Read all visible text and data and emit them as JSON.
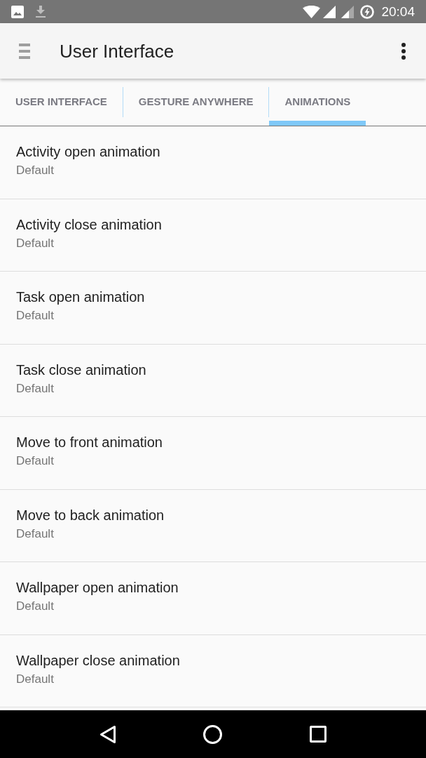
{
  "status_bar": {
    "time": "20:04"
  },
  "app_bar": {
    "title": "User Interface"
  },
  "tabs": [
    {
      "label": "USER INTERFACE",
      "selected": false
    },
    {
      "label": "GESTURE ANYWHERE",
      "selected": false
    },
    {
      "label": "ANIMATIONS",
      "selected": true
    }
  ],
  "settings": [
    {
      "title": "Activity open animation",
      "summary": "Default"
    },
    {
      "title": "Activity close animation",
      "summary": "Default"
    },
    {
      "title": "Task open animation",
      "summary": "Default"
    },
    {
      "title": "Task close animation",
      "summary": "Default"
    },
    {
      "title": "Move to front animation",
      "summary": "Default"
    },
    {
      "title": "Move to back animation",
      "summary": "Default"
    },
    {
      "title": "Wallpaper open animation",
      "summary": "Default"
    },
    {
      "title": "Wallpaper close animation",
      "summary": "Default"
    }
  ]
}
